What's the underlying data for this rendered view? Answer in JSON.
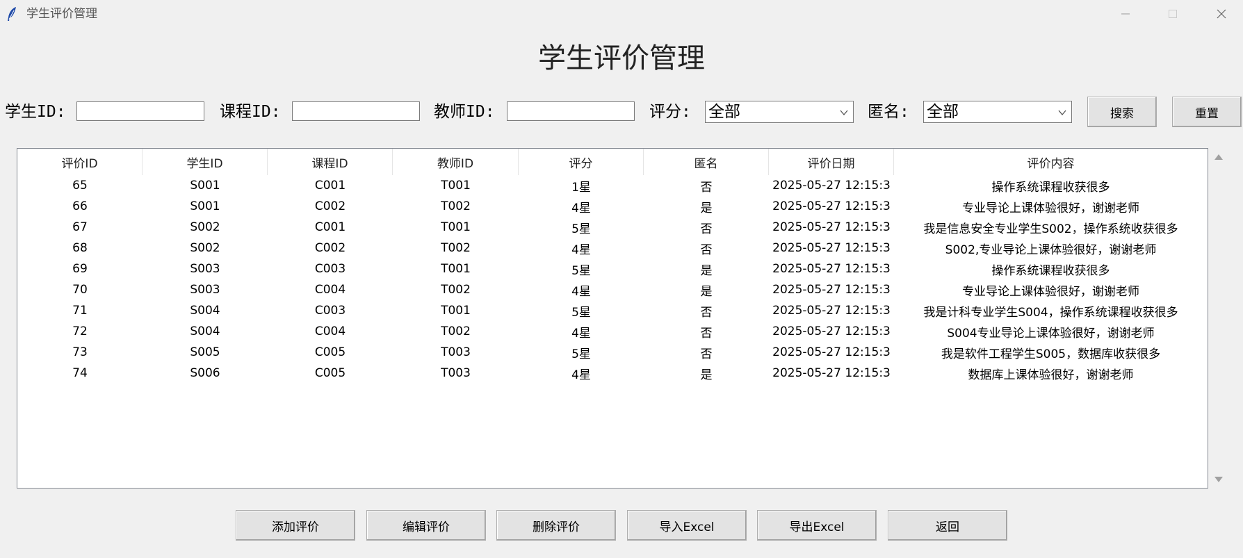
{
  "window": {
    "title": "学生评价管理",
    "icon": "feather-icon"
  },
  "header": {
    "title": "学生评价管理"
  },
  "filters": {
    "student_id_label": "学生ID:",
    "student_id_value": "",
    "course_id_label": "课程ID:",
    "course_id_value": "",
    "teacher_id_label": "教师ID:",
    "teacher_id_value": "",
    "rating_label": "评分:",
    "rating_value": "全部",
    "anonymous_label": "匿名:",
    "anonymous_value": "全部",
    "search_label": "搜索",
    "reset_label": "重置"
  },
  "table": {
    "columns": [
      "评价ID",
      "学生ID",
      "课程ID",
      "教师ID",
      "评分",
      "匿名",
      "评价日期",
      "评价内容"
    ],
    "rows": [
      [
        "65",
        "S001",
        "C001",
        "T001",
        "1星",
        "否",
        "2025-05-27 12:15:3",
        "操作系统课程收获很多"
      ],
      [
        "66",
        "S001",
        "C002",
        "T002",
        "4星",
        "是",
        "2025-05-27 12:15:3",
        "专业导论上课体验很好，谢谢老师"
      ],
      [
        "67",
        "S002",
        "C001",
        "T001",
        "5星",
        "否",
        "2025-05-27 12:15:3",
        "我是信息安全专业学生S002，操作系统收获很多"
      ],
      [
        "68",
        "S002",
        "C002",
        "T002",
        "4星",
        "否",
        "2025-05-27 12:15:3",
        "S002,专业导论上课体验很好，谢谢老师"
      ],
      [
        "69",
        "S003",
        "C003",
        "T001",
        "5星",
        "是",
        "2025-05-27 12:15:3",
        "操作系统课程收获很多"
      ],
      [
        "70",
        "S003",
        "C004",
        "T002",
        "4星",
        "是",
        "2025-05-27 12:15:3",
        "专业导论上课体验很好，谢谢老师"
      ],
      [
        "71",
        "S004",
        "C003",
        "T001",
        "5星",
        "否",
        "2025-05-27 12:15:3",
        "我是计科专业学生S004，操作系统课程收获很多"
      ],
      [
        "72",
        "S004",
        "C004",
        "T002",
        "4星",
        "否",
        "2025-05-27 12:15:3",
        "S004专业导论上课体验很好，谢谢老师"
      ],
      [
        "73",
        "S005",
        "C005",
        "T003",
        "5星",
        "否",
        "2025-05-27 12:15:3",
        "我是软件工程学生S005，数据库收获很多"
      ],
      [
        "74",
        "S006",
        "C005",
        "T003",
        "4星",
        "是",
        "2025-05-27 12:15:3",
        "数据库上课体验很好，谢谢老师"
      ]
    ]
  },
  "actions": {
    "add_label": "添加评价",
    "edit_label": "编辑评价",
    "delete_label": "删除评价",
    "import_label": "导入Excel",
    "export_label": "导出Excel",
    "back_label": "返回"
  }
}
